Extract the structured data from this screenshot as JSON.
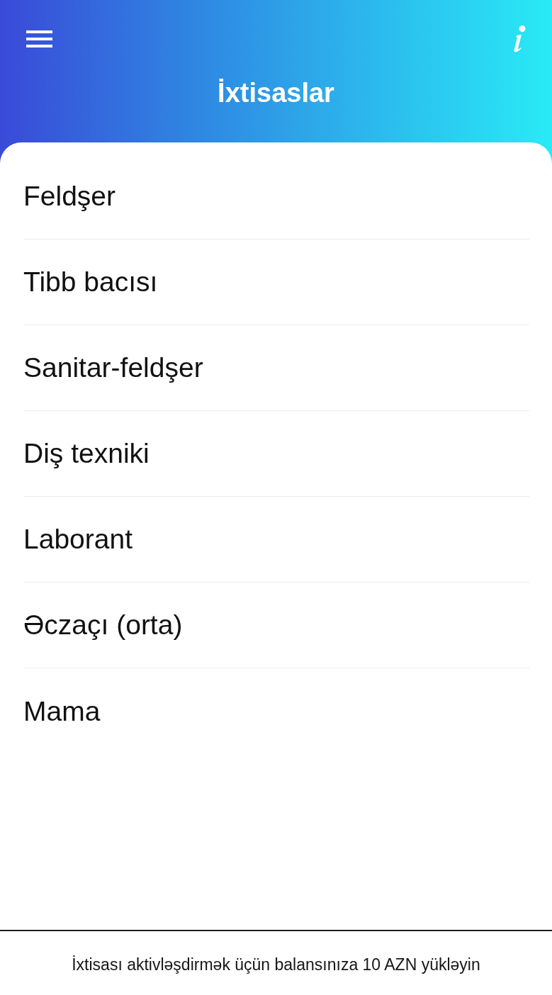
{
  "header": {
    "title": "İxtisaslar"
  },
  "specialties": [
    "Feldşer",
    "Tibb bacısı",
    "Sanitar-feldşer",
    "Diş texniki",
    "Laborant",
    "Əczaçı (orta)",
    "Mama"
  ],
  "footer": {
    "text": "İxtisası aktivləşdirmək üçün balansınıza 10 AZN yükləyin"
  }
}
